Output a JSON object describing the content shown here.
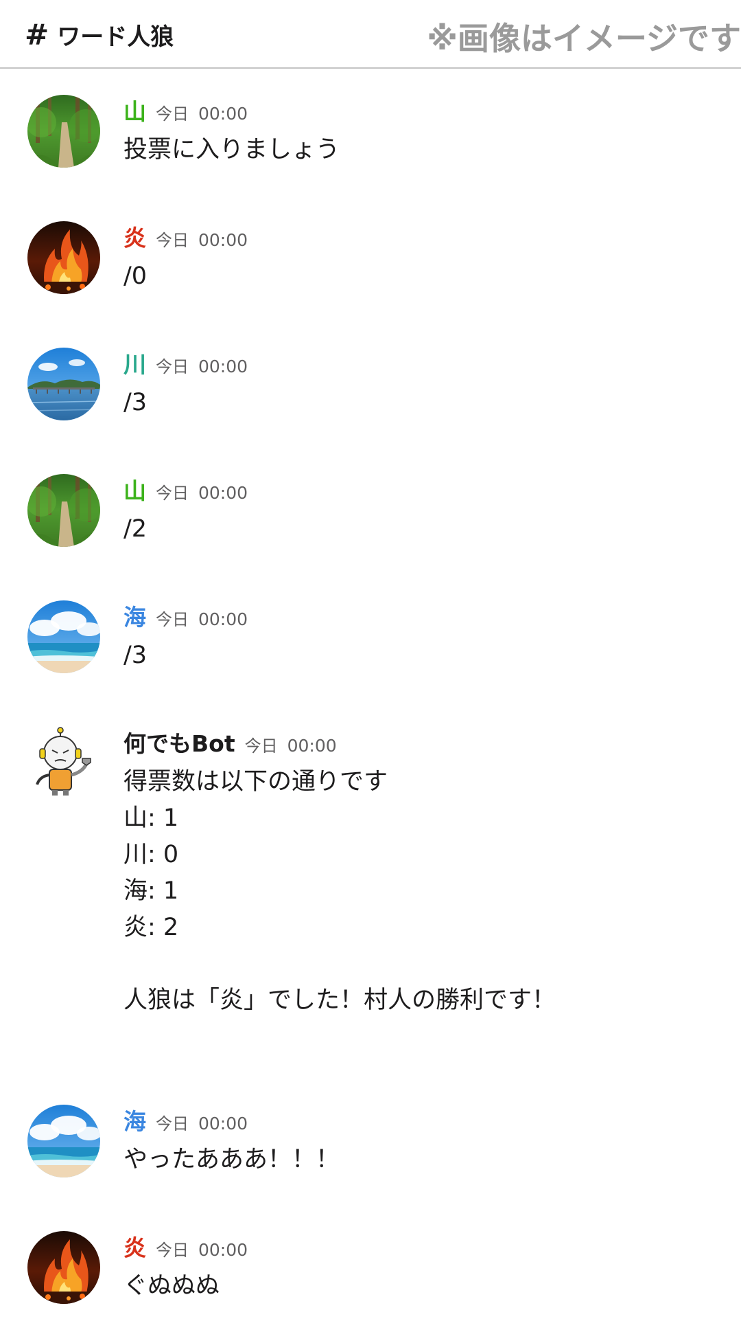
{
  "header": {
    "channel_name": "ワード人狼",
    "notice": "※画像はイメージです"
  },
  "colors": {
    "mountain": "#3db31c",
    "fire": "#d8311a",
    "river": "#29a88c",
    "sea": "#3a86e0",
    "bot": "#1d1c1d",
    "header_border": "#c4c4c4",
    "notice": "#9a9a9a"
  },
  "messages": [
    {
      "author": "山",
      "day": "今日",
      "time": "00:00",
      "text": "投票に入りましょう",
      "avatar": "forest-path-avatar"
    },
    {
      "author": "炎",
      "day": "今日",
      "time": "00:00",
      "text": "/0",
      "avatar": "fire-avatar"
    },
    {
      "author": "川",
      "day": "今日",
      "time": "00:00",
      "text": "/3",
      "avatar": "river-bridge-avatar"
    },
    {
      "author": "山",
      "day": "今日",
      "time": "00:00",
      "text": "/2",
      "avatar": "forest-path-avatar"
    },
    {
      "author": "海",
      "day": "今日",
      "time": "00:00",
      "text": "/3",
      "avatar": "sea-beach-avatar"
    },
    {
      "author": "何でもBot",
      "day": "今日",
      "time": "00:00",
      "text": "得票数は以下の通りです\n山: 1\n川: 0\n海: 1\n炎: 2\n\n人狼は「炎」でした！村人の勝利です！",
      "avatar": "robot-avatar"
    },
    {
      "author": "海",
      "day": "今日",
      "time": "00:00",
      "text": "やったあああ！！！",
      "avatar": "sea-beach-avatar"
    },
    {
      "author": "炎",
      "day": "今日",
      "time": "00:00",
      "text": "ぐぬぬぬ",
      "avatar": "fire-avatar"
    }
  ]
}
